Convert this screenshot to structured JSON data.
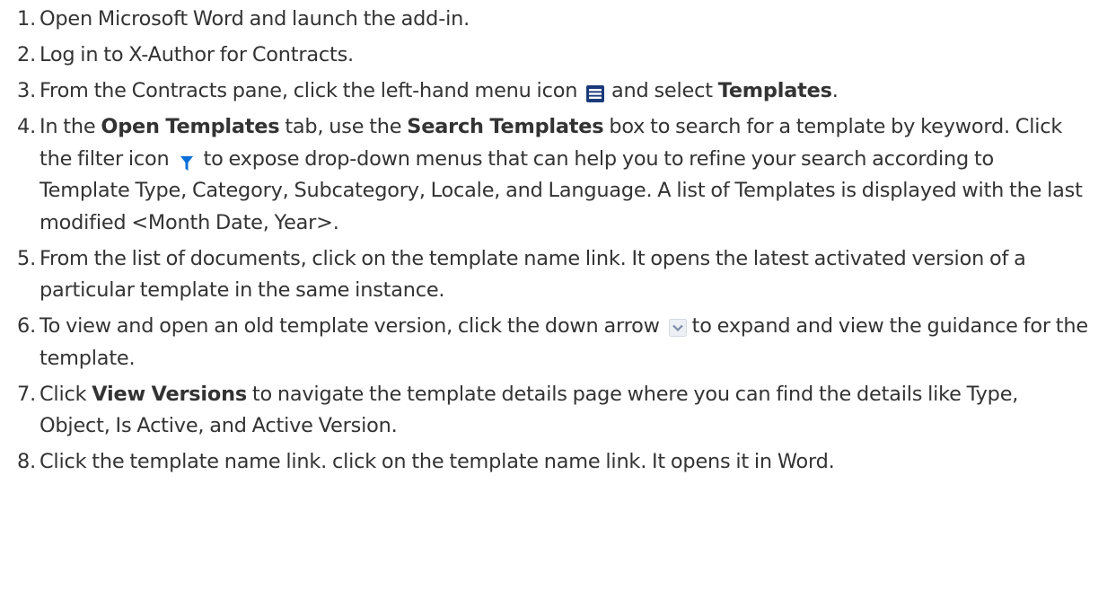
{
  "steps": [
    {
      "num": "1.",
      "parts": [
        {
          "t": "Open Microsoft Word and launch the add-in."
        }
      ]
    },
    {
      "num": "2.",
      "parts": [
        {
          "t": "Log in to X-Author for Contracts."
        }
      ]
    },
    {
      "num": "3.",
      "parts": [
        {
          "t": "From the Contracts pane, click the left-hand menu icon "
        },
        {
          "icon": "menu-icon"
        },
        {
          "t": " and select "
        },
        {
          "b": "Templates"
        },
        {
          "t": "."
        }
      ]
    },
    {
      "num": "4.",
      "parts": [
        {
          "t": "In the "
        },
        {
          "b": "Open Templates"
        },
        {
          "t": " tab, use the "
        },
        {
          "b": "Search Templates"
        },
        {
          "t": " box to search for a template by keyword. Click the filter icon"
        },
        {
          "icon": "filter-icon"
        },
        {
          "t": "to expose drop-down menus that can help you to refine your search according to Template Type, Category, Subcategory, Locale, and Language. A list of Templates is displayed with the last modified <Month Date, Year>."
        }
      ]
    },
    {
      "num": "5.",
      "parts": [
        {
          "t": "From the list of documents, click on the template name link. It opens the latest activated version of a particular template in the same instance."
        }
      ]
    },
    {
      "num": "6.",
      "parts": [
        {
          "t": "To view and open an old template version, click the down arrow "
        },
        {
          "icon": "chevron-down-icon"
        },
        {
          "t": "to expand and view the guidance for the template."
        }
      ]
    },
    {
      "num": "7.",
      "parts": [
        {
          "t": "Click "
        },
        {
          "b": "View Versions"
        },
        {
          "t": " to navigate the template details page where you can find the details like Type, Object, Is Active, and Active Version."
        }
      ]
    },
    {
      "num": "8.",
      "parts": [
        {
          "t": "Click the template name link. click on the template name link. It opens it in Word."
        }
      ]
    }
  ],
  "colors": {
    "text": "#333333",
    "menu_icon": "#1a3a7a",
    "filter_icon": "#0a6fd8",
    "arrow_icon_bg": "#eceff4",
    "arrow_icon_fg": "#7c8aa6"
  }
}
